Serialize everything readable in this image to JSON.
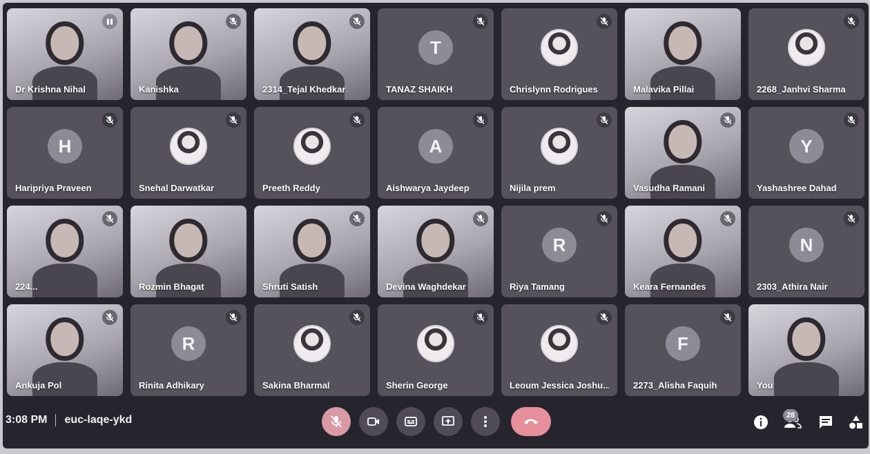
{
  "meeting": {
    "time": "3:08 PM",
    "code": "euc-laqe-ykd"
  },
  "participants_count": "28",
  "participants": [
    {
      "name": "Dr Krishna Nihal",
      "type": "video",
      "mic": "speaking"
    },
    {
      "name": "Kanishka",
      "type": "video",
      "mic": "muted"
    },
    {
      "name": "2314_Tejal Khedkar",
      "type": "video",
      "mic": "muted"
    },
    {
      "name": "TANAZ SHAIKH",
      "type": "initial",
      "initial": "T",
      "mic": "muted"
    },
    {
      "name": "Chrislynn Rodrigues",
      "type": "photo",
      "mic": "muted"
    },
    {
      "name": "Malavika Pillai",
      "type": "video",
      "mic": "none"
    },
    {
      "name": "2268_Janhvi Sharma",
      "type": "photo",
      "mic": "muted"
    },
    {
      "name": "Haripriya Praveen",
      "type": "initial",
      "initial": "H",
      "mic": "muted"
    },
    {
      "name": "Snehal Darwatkar",
      "type": "photo",
      "mic": "muted"
    },
    {
      "name": "Preeth Reddy",
      "type": "photo",
      "mic": "muted"
    },
    {
      "name": "Aishwarya Jaydeep",
      "type": "initial",
      "initial": "A",
      "mic": "muted"
    },
    {
      "name": "Nijila prem",
      "type": "photo",
      "mic": "muted"
    },
    {
      "name": "Vasudha Ramani",
      "type": "video",
      "mic": "muted"
    },
    {
      "name": "Yashashree Dahad",
      "type": "initial",
      "initial": "Y",
      "mic": "muted"
    },
    {
      "name": "224...",
      "type": "video",
      "mic": "muted"
    },
    {
      "name": "Rozmin Bhagat",
      "type": "video",
      "mic": "none"
    },
    {
      "name": "Shruti Satish",
      "type": "video",
      "mic": "muted"
    },
    {
      "name": "Devina Waghdekar",
      "type": "video",
      "mic": "muted"
    },
    {
      "name": "Riya Tamang",
      "type": "initial",
      "initial": "R",
      "mic": "muted"
    },
    {
      "name": "Keara Fernandes",
      "type": "video",
      "mic": "muted"
    },
    {
      "name": "2303_Athira Nair",
      "type": "initial",
      "initial": "N",
      "mic": "muted"
    },
    {
      "name": "Ankuja Pol",
      "type": "video",
      "mic": "muted"
    },
    {
      "name": "Rinita Adhikary",
      "type": "initial",
      "initial": "R",
      "mic": "muted"
    },
    {
      "name": "Sakina Bharmal",
      "type": "photo",
      "mic": "muted"
    },
    {
      "name": "Sherin George",
      "type": "photo",
      "mic": "muted"
    },
    {
      "name": "Leoum Jessica Joshu...",
      "type": "photo",
      "mic": "muted"
    },
    {
      "name": "2273_Alisha Faquih",
      "type": "initial",
      "initial": "F",
      "mic": "muted"
    },
    {
      "name": "You",
      "type": "video",
      "mic": "none"
    }
  ],
  "icons": {
    "controls": [
      "mic-off-icon",
      "camera-icon",
      "captions-icon",
      "present-icon",
      "more-options-icon",
      "end-call-icon"
    ],
    "right": [
      "info-icon",
      "people-icon",
      "chat-icon",
      "activities-icon"
    ]
  }
}
